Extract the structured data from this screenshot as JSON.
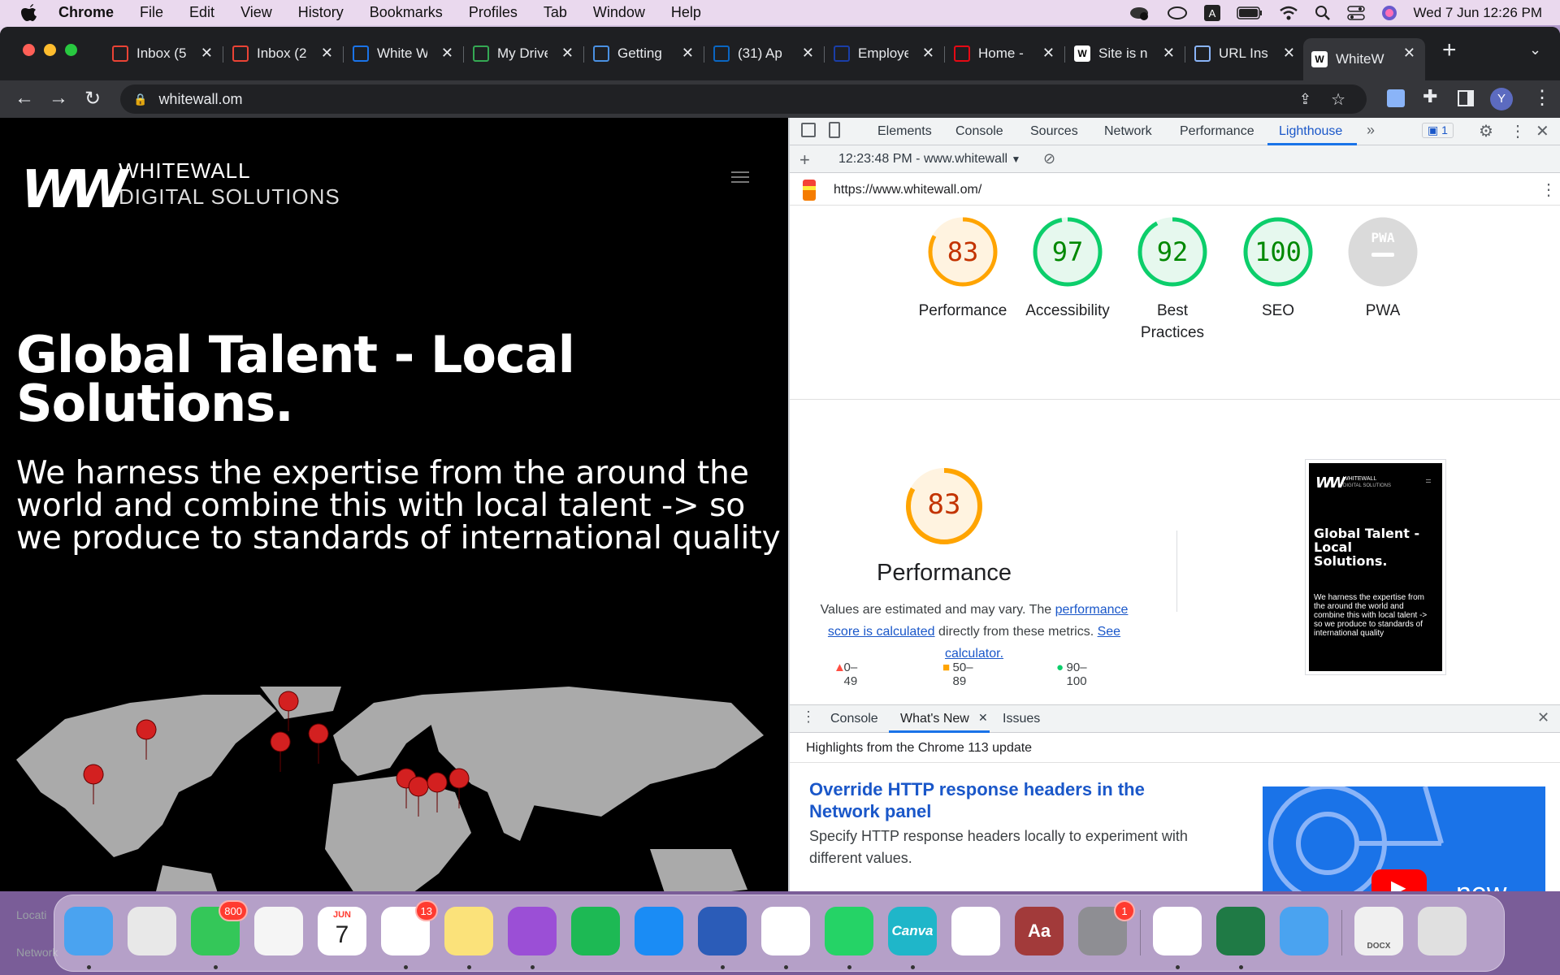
{
  "menubar": {
    "app": "Chrome",
    "items": [
      "File",
      "Edit",
      "View",
      "History",
      "Bookmarks",
      "Profiles",
      "Tab",
      "Window",
      "Help"
    ],
    "datetime": "Wed 7 Jun  12:26 PM"
  },
  "tabs": [
    {
      "title": "Inbox (5",
      "icon": "gmail-icon",
      "color": "#ea4335"
    },
    {
      "title": "Inbox (2",
      "icon": "gmail-icon",
      "color": "#ea4335"
    },
    {
      "title": "White W",
      "icon": "calendar-icon",
      "color": "#1a73e8"
    },
    {
      "title": "My Drive",
      "icon": "drive-icon",
      "color": "#34a853"
    },
    {
      "title": "Getting",
      "icon": "mi-icon",
      "color": "#4a90e2"
    },
    {
      "title": "(31) Ap",
      "icon": "linkedin-icon",
      "color": "#0a66c2"
    },
    {
      "title": "Employe",
      "icon": "info-icon",
      "color": "#1a3ea8"
    },
    {
      "title": "Home -",
      "icon": "netflix-icon",
      "color": "#e50914"
    },
    {
      "title": "Site is n",
      "icon": "w-icon",
      "color": "#ffffff"
    },
    {
      "title": "URL Ins",
      "icon": "search-console-icon",
      "color": "#8ab4f8"
    },
    {
      "title": "WhiteW",
      "icon": "whitewall-icon",
      "color": "#ffffff"
    }
  ],
  "address_bar": {
    "url": "whitewall.om"
  },
  "page": {
    "brand_line1": "WHITEWALL",
    "brand_line2": "DIGITAL SOLUTIONS",
    "logo": "W",
    "hero_title": "Global Talent - Local Solutions.",
    "hero_subtitle": "We harness the expertise from the around the world and combine this with local talent -> so we produce to standards of international quality"
  },
  "devtools": {
    "tabs": [
      "Elements",
      "Console",
      "Sources",
      "Network",
      "Performance",
      "Lighthouse"
    ],
    "active_tab": "Lighthouse",
    "issues_count": "1",
    "report_time": "12:23:48 PM - www.whitewall",
    "report_url": "https://www.whitewall.om/",
    "scores": [
      {
        "label": "Performance",
        "value": "83",
        "fraction": 0.83,
        "color": "#ffa400",
        "text": "#c33300",
        "bg": "#fff3e0"
      },
      {
        "label": "Accessibility",
        "value": "97",
        "fraction": 0.97,
        "color": "#0cce6b",
        "text": "#008800",
        "bg": "#e6f8ee"
      },
      {
        "label": "Best Practices",
        "value": "92",
        "fraction": 0.92,
        "color": "#0cce6b",
        "text": "#008800",
        "bg": "#e6f8ee"
      },
      {
        "label": "SEO",
        "value": "100",
        "fraction": 1.0,
        "color": "#0cce6b",
        "text": "#008800",
        "bg": "#e6f8ee"
      },
      {
        "label": "PWA",
        "value": "PWA",
        "fraction": 0,
        "color": "#dadada",
        "text": "#ffffff",
        "bg": "#dadada"
      }
    ],
    "perf_detail": {
      "score": "83",
      "title": "Performance",
      "desc_1": "Values are estimated and may vary. The ",
      "link_1": "performance score is calculated",
      "desc_2": " directly from these metrics. ",
      "link_2": "See calculator.",
      "legend": [
        {
          "range": "0–49",
          "color": "#ff4e42"
        },
        {
          "range": "50–89",
          "color": "#ffa400"
        },
        {
          "range": "90–100",
          "color": "#0cce6b"
        }
      ]
    },
    "thumbnail": {
      "brand1": "WHITEWALL",
      "brand2": "DIGITAL SOLUTIONS",
      "title": "Global Talent - Local Solutions.",
      "text": "We harness the expertise from the around the world and combine this with local talent -> so we produce to standards of international quality"
    },
    "drawer": {
      "tabs": [
        "Console",
        "What's New",
        "Issues"
      ],
      "active_tab": "What's New",
      "highlights": "Highlights from the Chrome 113 update",
      "feature_title": "Override HTTP response headers in the Network panel",
      "feature_desc": "Specify HTTP response headers locally to experiment with different values.",
      "video_label": "new"
    }
  },
  "dock": {
    "left_text": "Locati",
    "left_text2": "Network",
    "apps": [
      {
        "name": "Finder",
        "icon": "finder-icon",
        "color": "#4aa3f0"
      },
      {
        "name": "Launchpad",
        "icon": "launchpad-icon",
        "color": "#e8e8e8"
      },
      {
        "name": "Messages",
        "icon": "messages-icon",
        "color": "#34c759",
        "badge": "800"
      },
      {
        "name": "Photos",
        "icon": "photos-icon",
        "color": "#f5f5f5"
      },
      {
        "name": "Calendar",
        "icon": "calendar-icon",
        "color": "#ffffff",
        "month": "JUN",
        "day": "7"
      },
      {
        "name": "Reminders",
        "icon": "reminders-icon",
        "color": "#ffffff",
        "badge": "13"
      },
      {
        "name": "Notes",
        "icon": "notes-icon",
        "color": "#fbe27a"
      },
      {
        "name": "Podcasts",
        "icon": "podcasts-icon",
        "color": "#9b4fd6"
      },
      {
        "name": "Spotify",
        "icon": "spotify-icon",
        "color": "#1db954"
      },
      {
        "name": "App Store",
        "icon": "app-store-icon",
        "color": "#1a8cf5"
      },
      {
        "name": "Word",
        "icon": "word-icon",
        "color": "#2b5cb8"
      },
      {
        "name": "Chrome",
        "icon": "chrome-icon",
        "color": "#ffffff"
      },
      {
        "name": "WhatsApp",
        "icon": "whatsapp-icon",
        "color": "#25d366"
      },
      {
        "name": "Canva",
        "icon": "canva-icon",
        "color": "#1fb6c9",
        "text": "Canva"
      },
      {
        "name": "OneDrive",
        "icon": "onedrive-icon",
        "color": "#ffffff"
      },
      {
        "name": "Dictionary",
        "icon": "dictionary-icon",
        "color": "#a23a3a",
        "text": "Aa"
      },
      {
        "name": "System Preferences",
        "icon": "settings-icon",
        "color": "#8e8e93",
        "badge": "1"
      },
      {
        "name": "Acrobat",
        "icon": "acrobat-icon",
        "color": "#ffffff"
      },
      {
        "name": "Excel",
        "icon": "excel-icon",
        "color": "#1f7a45"
      },
      {
        "name": "Mail",
        "icon": "mail-icon",
        "color": "#4aa3f0"
      },
      {
        "name": "DOCX",
        "icon": "docx-file-icon",
        "color": "#f0f0f0",
        "text": "DOCX"
      },
      {
        "name": "Trash",
        "icon": "trash-icon",
        "color": "#e0e0e0"
      }
    ]
  }
}
